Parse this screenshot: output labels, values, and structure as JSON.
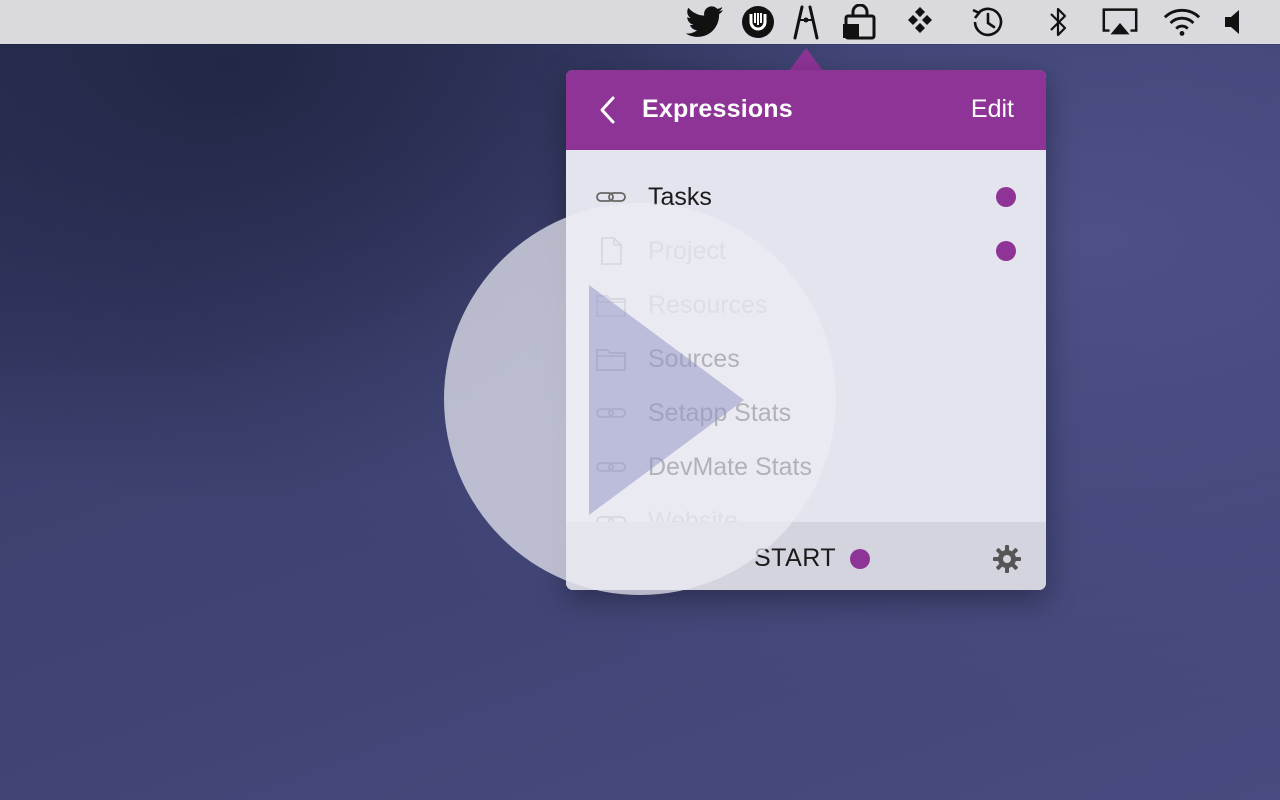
{
  "menubar": {
    "items": [
      {
        "icon": "twitter-icon"
      },
      {
        "icon": "shield-logo-icon"
      },
      {
        "icon": "pliers-icon"
      },
      {
        "icon": "lock-bag-icon"
      },
      {
        "icon": "diamond-grid-icon"
      },
      {
        "icon": "time-machine-icon"
      },
      {
        "icon": "bluetooth-icon"
      },
      {
        "icon": "airplay-icon"
      },
      {
        "icon": "wifi-icon"
      },
      {
        "icon": "volume-icon"
      }
    ]
  },
  "popover": {
    "title": "Expressions",
    "back_icon": "chevron-left-icon",
    "edit_label": "Edit",
    "accent": "#8e3497",
    "items": [
      {
        "label": "Tasks",
        "icon": "link-icon",
        "dot": true,
        "dim": false
      },
      {
        "label": "Project",
        "icon": "document-icon",
        "dot": true,
        "dim": true
      },
      {
        "label": "Resources",
        "icon": "folder-icon",
        "dot": false,
        "dim": true
      },
      {
        "label": "Sources",
        "icon": "folder-icon",
        "dot": false,
        "dim": false
      },
      {
        "label": "Setapp Stats",
        "icon": "link-icon",
        "dot": false,
        "dim": false
      },
      {
        "label": "DevMate Stats",
        "icon": "link-icon",
        "dot": false,
        "dim": false
      },
      {
        "label": "Website",
        "icon": "link-icon",
        "dot": false,
        "dim": true
      }
    ],
    "footer": {
      "start_label": "START",
      "gear_icon": "gear-icon"
    }
  },
  "overlay": {
    "icon": "play-icon"
  }
}
